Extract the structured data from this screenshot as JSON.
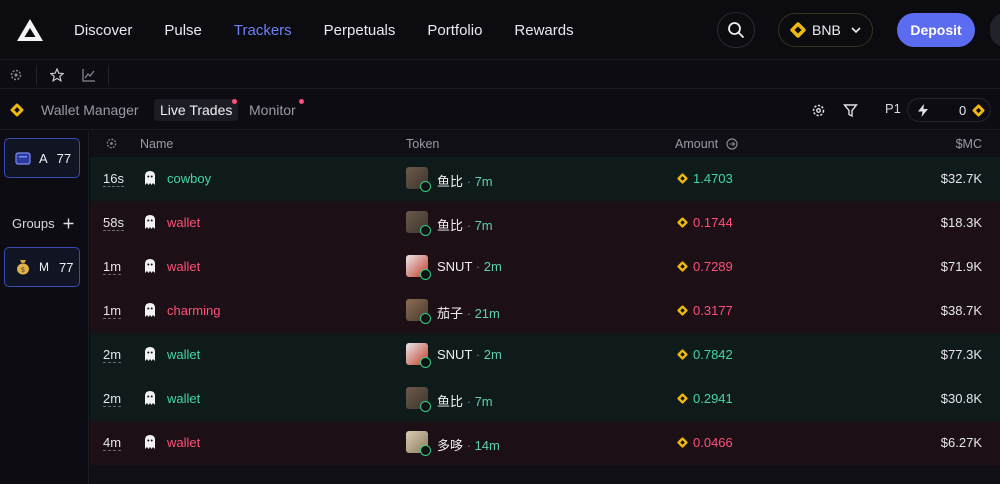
{
  "nav": {
    "links": [
      "Discover",
      "Pulse",
      "Trackers",
      "Perpetuals",
      "Portfolio",
      "Rewards"
    ],
    "active_index": 2,
    "chain_label": "BNB",
    "deposit_label": "Deposit"
  },
  "tabs": {
    "wallet_manager": "Wallet Manager",
    "live_trades": "Live Trades",
    "monitor": "Monitor",
    "page_label": "P1",
    "balance": "0"
  },
  "sidebar": {
    "wallet_card": {
      "letter": "A",
      "count": "77"
    },
    "groups_label": "Groups",
    "group_card": {
      "letter": "M",
      "count": "77"
    }
  },
  "table": {
    "headers": {
      "name": "Name",
      "token": "Token",
      "amount": "Amount",
      "mc": "$MC"
    },
    "rows": [
      {
        "age": "16s",
        "wallet": "cowboy",
        "token": "鱼比",
        "token_age": "7m",
        "amount": "1.4703",
        "mc": "$32.7K",
        "side": "buy"
      },
      {
        "age": "58s",
        "wallet": "wallet",
        "token": "鱼比",
        "token_age": "7m",
        "amount": "0.1744",
        "mc": "$18.3K",
        "side": "sell"
      },
      {
        "age": "1m",
        "wallet": "wallet",
        "token": "SNUT",
        "token_age": "2m",
        "amount": "0.7289",
        "mc": "$71.9K",
        "side": "sell"
      },
      {
        "age": "1m",
        "wallet": "charming",
        "token": "茄子",
        "token_age": "21m",
        "amount": "0.3177",
        "mc": "$38.7K",
        "side": "sell"
      },
      {
        "age": "2m",
        "wallet": "wallet",
        "token": "SNUT",
        "token_age": "2m",
        "amount": "0.7842",
        "mc": "$77.3K",
        "side": "buy"
      },
      {
        "age": "2m",
        "wallet": "wallet",
        "token": "鱼比",
        "token_age": "7m",
        "amount": "0.2941",
        "mc": "$30.8K",
        "side": "buy"
      },
      {
        "age": "4m",
        "wallet": "wallet",
        "token": "多哆",
        "token_age": "14m",
        "amount": "0.0466",
        "mc": "$6.27K",
        "side": "sell"
      }
    ]
  },
  "colors": {
    "accent": "#6f7ff5",
    "buy": "#44d6a2",
    "sell": "#ff4f7a",
    "bnb": "#f0b90b"
  }
}
